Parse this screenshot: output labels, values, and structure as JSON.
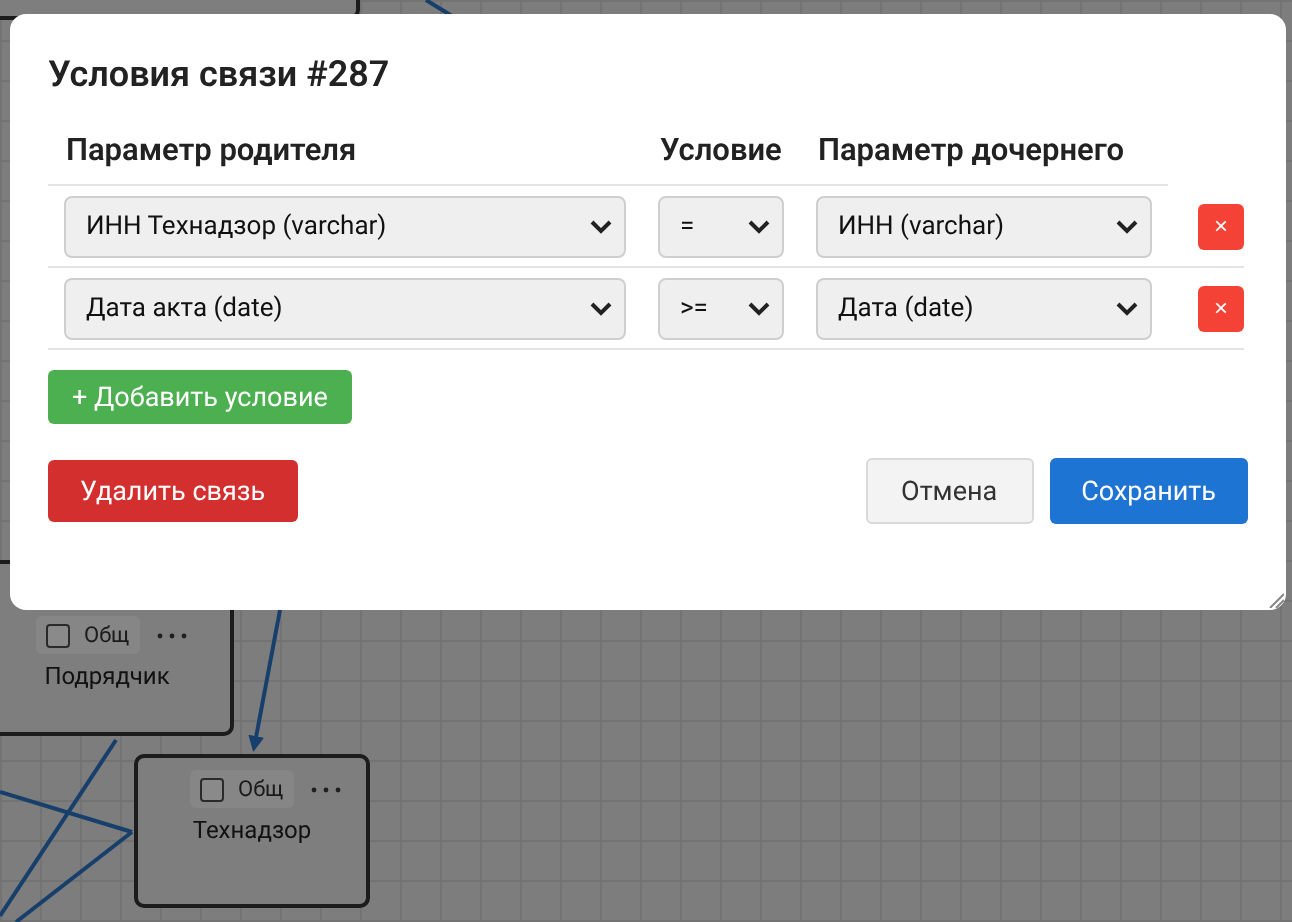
{
  "canvas": {
    "nodes": [
      {
        "label": "Подрядчик",
        "checkbox_label": "Общ",
        "checked": false
      },
      {
        "label": "Технадзор",
        "checkbox_label": "Общ",
        "checked": false
      }
    ]
  },
  "dialog": {
    "title": "Условия связи #287",
    "columns": [
      "Параметр родителя",
      "Условие",
      "Параметр дочернего"
    ],
    "rows": [
      {
        "parent": "ИНН Технадзор (varchar)",
        "operator": "=",
        "child": "ИНН (varchar)",
        "delete": "×"
      },
      {
        "parent": "Дата акта (date)",
        "operator": ">=",
        "child": "Дата (date)",
        "delete": "×"
      }
    ],
    "add_button": "+ Добавить условие",
    "delete_button": "Удалить связь",
    "cancel_button": "Отмена",
    "save_button": "Сохранить"
  }
}
